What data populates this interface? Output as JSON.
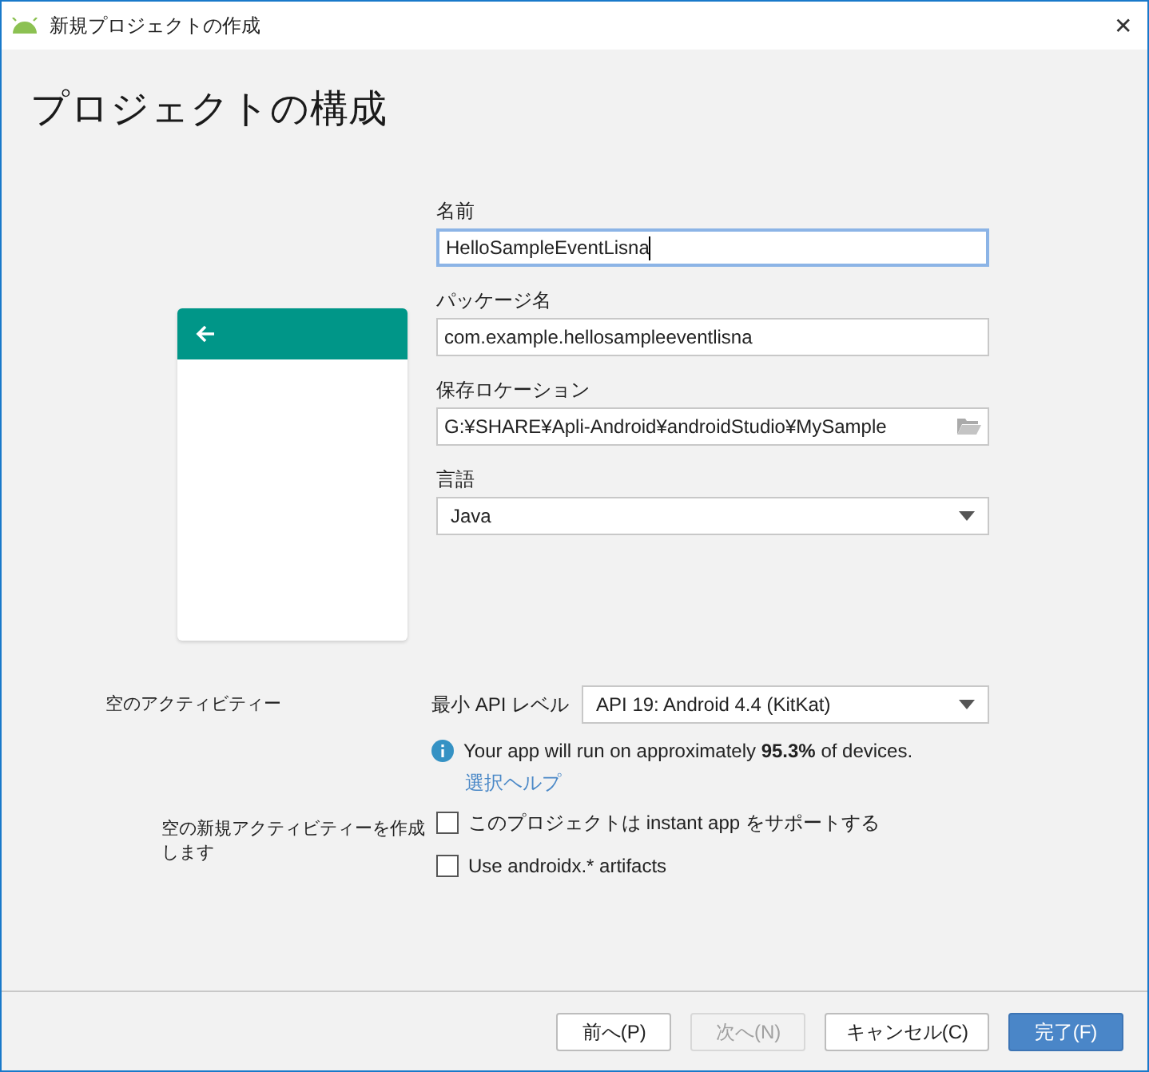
{
  "window": {
    "title": "新規プロジェクトの作成",
    "close": "✕"
  },
  "heading": "プロジェクトの構成",
  "fields": [
    {
      "label": "名前",
      "value": "HelloSampleEventLisna",
      "kind": "text",
      "focused": true
    },
    {
      "label": "パッケージ名",
      "value": "com.example.hellosampleeventlisna",
      "kind": "text",
      "focused": false
    },
    {
      "label": "保存ロケーション",
      "value": "G:¥SHARE¥Apli-Android¥androidStudio¥MySample",
      "kind": "folder",
      "focused": false
    },
    {
      "label": "言語",
      "value": "Java",
      "kind": "select",
      "focused": false
    }
  ],
  "preview": {
    "title": "空のアクティビティー",
    "description": "空の新規アクティビティーを作成します"
  },
  "min_api": {
    "label": "最小 API レベル",
    "value": "API 19: Android 4.4 (KitKat)",
    "info": "Your app will run on approximately **95.3%** of devices.",
    "help_link": "選択ヘルプ"
  },
  "checkboxes": [
    {
      "label": "このプロジェクトは instant app をサポートする",
      "checked": false
    },
    {
      "label": "Use androidx.* artifacts",
      "checked": false
    }
  ],
  "buttons": [
    {
      "label": "前へ(P)",
      "disabled": false,
      "primary": false
    },
    {
      "label": "次へ(N)",
      "disabled": true,
      "primary": false
    },
    {
      "label": "キャンセル(C)",
      "disabled": false,
      "primary": false
    },
    {
      "label": "完了(F)",
      "disabled": false,
      "primary": true
    }
  ]
}
